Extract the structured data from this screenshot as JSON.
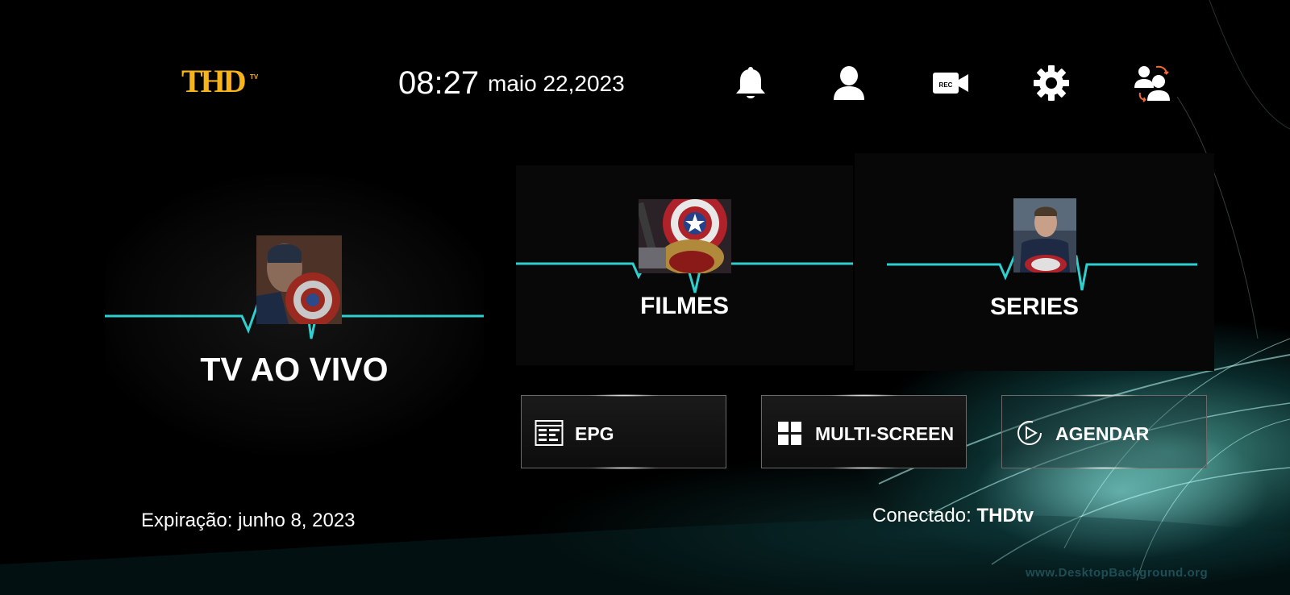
{
  "header": {
    "logo_text": "THD",
    "logo_sub": "TV",
    "time": "08:27",
    "date": "maio 22,2023",
    "icons": [
      "bell-icon",
      "user-icon",
      "rec-camera-icon",
      "gear-icon",
      "switch-user-icon"
    ],
    "rec_label": "REC"
  },
  "menu": {
    "live_label": "TV AO VIVO",
    "movies_label": "FILMES",
    "series_label": "SERIES"
  },
  "buttons": {
    "epg_label": "EPG",
    "multiscreen_label": "MULTI-SCREEN",
    "schedule_label": "AGENDAR"
  },
  "footer": {
    "expiry_label": "Expiração:",
    "expiry_value": "junho 8, 2023",
    "connected_label": "Conectado:",
    "connected_value": "THDtv",
    "watermark": "www.DesktopBackground.org"
  },
  "colors": {
    "accent_logo": "#f6b31a",
    "pulse_line": "#33e6e6",
    "background": "#000000"
  }
}
